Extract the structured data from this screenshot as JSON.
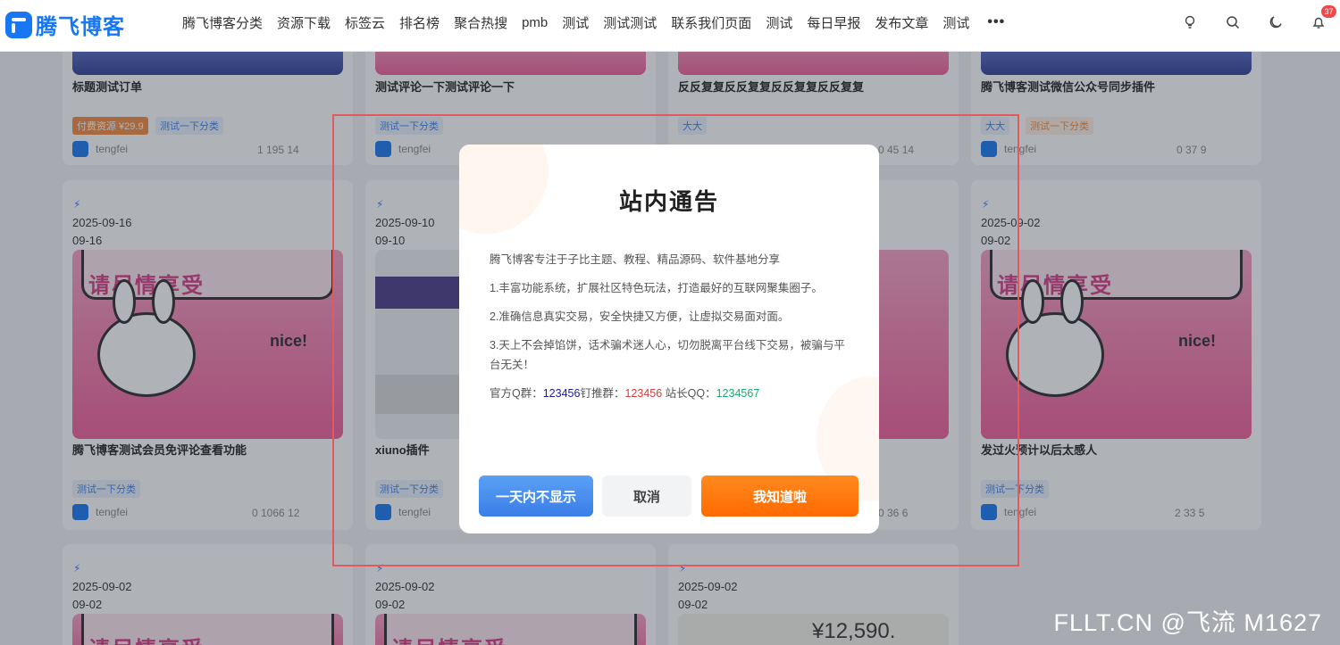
{
  "header": {
    "logo_text": "腾飞博客",
    "nav": [
      "腾飞博客分类",
      "资源下载",
      "标签云",
      "排名榜",
      "聚合热搜",
      "pmb",
      "测试",
      "测试测试",
      "联系我们页面",
      "测试",
      "每日早报",
      "发布文章",
      "测试"
    ],
    "more": "•••",
    "notification_count": "37"
  },
  "row1": [
    {
      "title": "标题测试订单",
      "tags": [
        "付费资源 ¥29.9",
        "测试一下分类"
      ],
      "author": "tengfei",
      "stats": "1  195  14"
    },
    {
      "title": "测试评论一下测试评论一下",
      "tags": [
        "测试一下分类"
      ],
      "author": "tengfei",
      "stats": ""
    },
    {
      "title": "反反复复反反复复反反复复反反复复",
      "tags": [
        "大大"
      ],
      "author": "",
      "stats": "0  45  14"
    },
    {
      "title": "腾飞博客测试微信公众号同步插件",
      "tags": [
        "大大",
        "测试一下分类"
      ],
      "author": "tengfei",
      "stats": "0  37  9"
    }
  ],
  "row2": [
    {
      "date": "2025-09-16",
      "short": "09-16",
      "thumb_text": "请尽情享受",
      "nice": "nice!",
      "title": "腾飞博客测试会员免评论查看功能",
      "tag": "测试一下分类",
      "author": "tengfei",
      "stats": "0  1066  12"
    },
    {
      "date": "2025-09-10",
      "short": "09-10",
      "title": "xiuno插件",
      "tag": "测试一下分类",
      "author": "tengfei",
      "stats": ""
    },
    {
      "stats": "0  36  6"
    },
    {
      "date": "2025-09-02",
      "short": "09-02",
      "thumb_text": "请尽情享受",
      "nice": "nice!",
      "title": "发过火预计以后太感人",
      "tag": "测试一下分类",
      "author": "tengfei",
      "stats": "2  33  5"
    }
  ],
  "row3": [
    {
      "date": "2025-09-02",
      "short": "09-02",
      "thumb_text": "请尽情享受"
    },
    {
      "date": "2025-09-02",
      "short": "09-02",
      "thumb_text": "请尽情享受"
    },
    {
      "date": "2025-09-02",
      "short": "09-02",
      "price": "¥12,590."
    }
  ],
  "modal": {
    "title": "站内通告",
    "intro": "腾飞博客专注于子比主题、教程、精品源码、软件基地分享",
    "p1": "1.丰富功能系统，扩展社区特色玩法，打造最好的互联网聚集圈子。",
    "p2": "2.准确信息真实交易，安全快捷又方便，让虚拟交易面对面。",
    "p3": "3.天上不会掉馅饼，话术骗术迷人心，切勿脱离平台线下交易，被骗与平台无关！",
    "qq_group_label": "官方Q群：",
    "qq_group": "123456",
    "push_group_label": "钉推群：",
    "push_group": "123456",
    "owner_qq_label": " 站长QQ：",
    "owner_qq": "1234567",
    "btn_hide_day": "一天内不显示",
    "btn_cancel": "取消",
    "btn_ok": "我知道啦"
  },
  "watermark": "FLLT.CN @飞流 M1627"
}
